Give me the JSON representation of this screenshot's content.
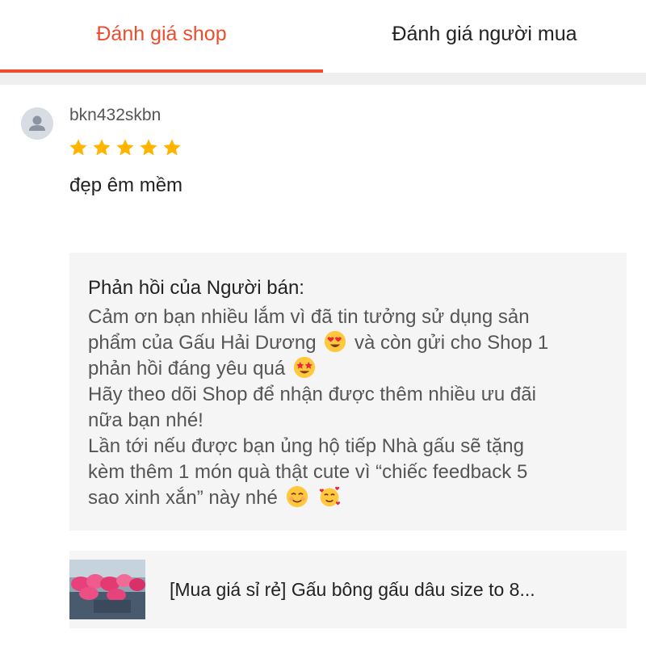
{
  "tabs": [
    {
      "label": "Đánh giá shop",
      "active": true
    },
    {
      "label": "Đánh giá người mua",
      "active": false
    }
  ],
  "review": {
    "username": "bkn432skbn",
    "rating": 5,
    "rating_max": 5,
    "text": "đẹp êm mềm"
  },
  "reply": {
    "title": "Phản hồi của Người bán:",
    "lines": [
      "Cảm ơn bạn nhiều lắm vì đã tin tưởng sử dụng sản",
      "phẩm của Gấu Hải Dương",
      "và còn gửi cho Shop 1",
      "phản hồi đáng yêu quá",
      "Hãy theo dõi Shop để nhận được thêm nhiều ưu đãi",
      "nữa bạn nhé!",
      "Lần tới nếu được bạn ủng hộ tiếp Nhà gấu sẽ tặng",
      "kèm thêm 1 món quà thật cute vì “chiếc feedback 5",
      "sao xinh xắn” này nhé"
    ]
  },
  "product": {
    "name": "[Mua giá sỉ rẻ] Gấu bông gấu dâu size to 8..."
  },
  "colors": {
    "accent": "#ee4d2d",
    "star": "#ffb400",
    "reply_bg": "#f5f5f5"
  },
  "icons": [
    "avatar-placeholder-icon",
    "star-icon",
    "heart-eyes-emoji",
    "star-struck-emoji",
    "smiling-emoji",
    "smiling-hearts-emoji"
  ]
}
